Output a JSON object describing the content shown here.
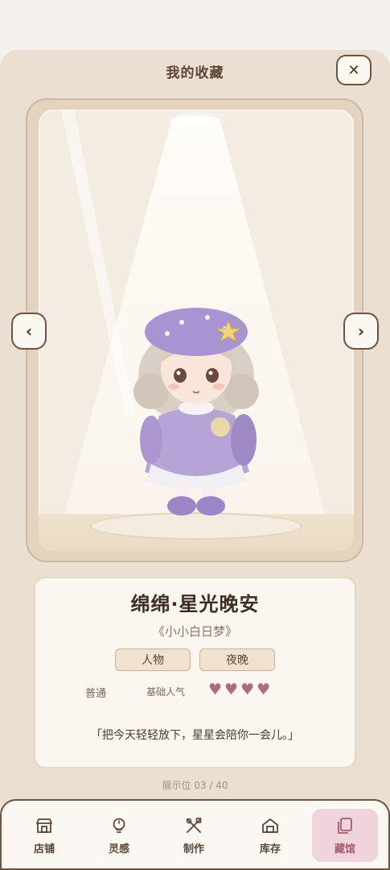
{
  "header": {
    "title": "我的收藏"
  },
  "figure": {
    "name": "绵绵·星光晚安",
    "series": "《小小白日梦》",
    "tags": [
      "人物",
      "夜晚"
    ],
    "rarity": "普通",
    "popularity_label": "基础人气",
    "popularity_hearts": 4,
    "quote": "「把今天轻轻放下，星星会陪你一会儿。」"
  },
  "slot_text": "展示位 03 / 40",
  "nav": {
    "items": [
      {
        "label": "店铺",
        "icon": "shop-icon"
      },
      {
        "label": "灵感",
        "icon": "lightbulb-icon"
      },
      {
        "label": "制作",
        "icon": "tools-icon"
      },
      {
        "label": "库存",
        "icon": "house-icon"
      },
      {
        "label": "藏馆",
        "icon": "collection-icon"
      }
    ],
    "active_index": 4
  },
  "colors": {
    "accent": "#a45b6f",
    "active_bg": "#efd4dc",
    "sheet_bg": "#eadfd0",
    "border": "#6d5443"
  }
}
